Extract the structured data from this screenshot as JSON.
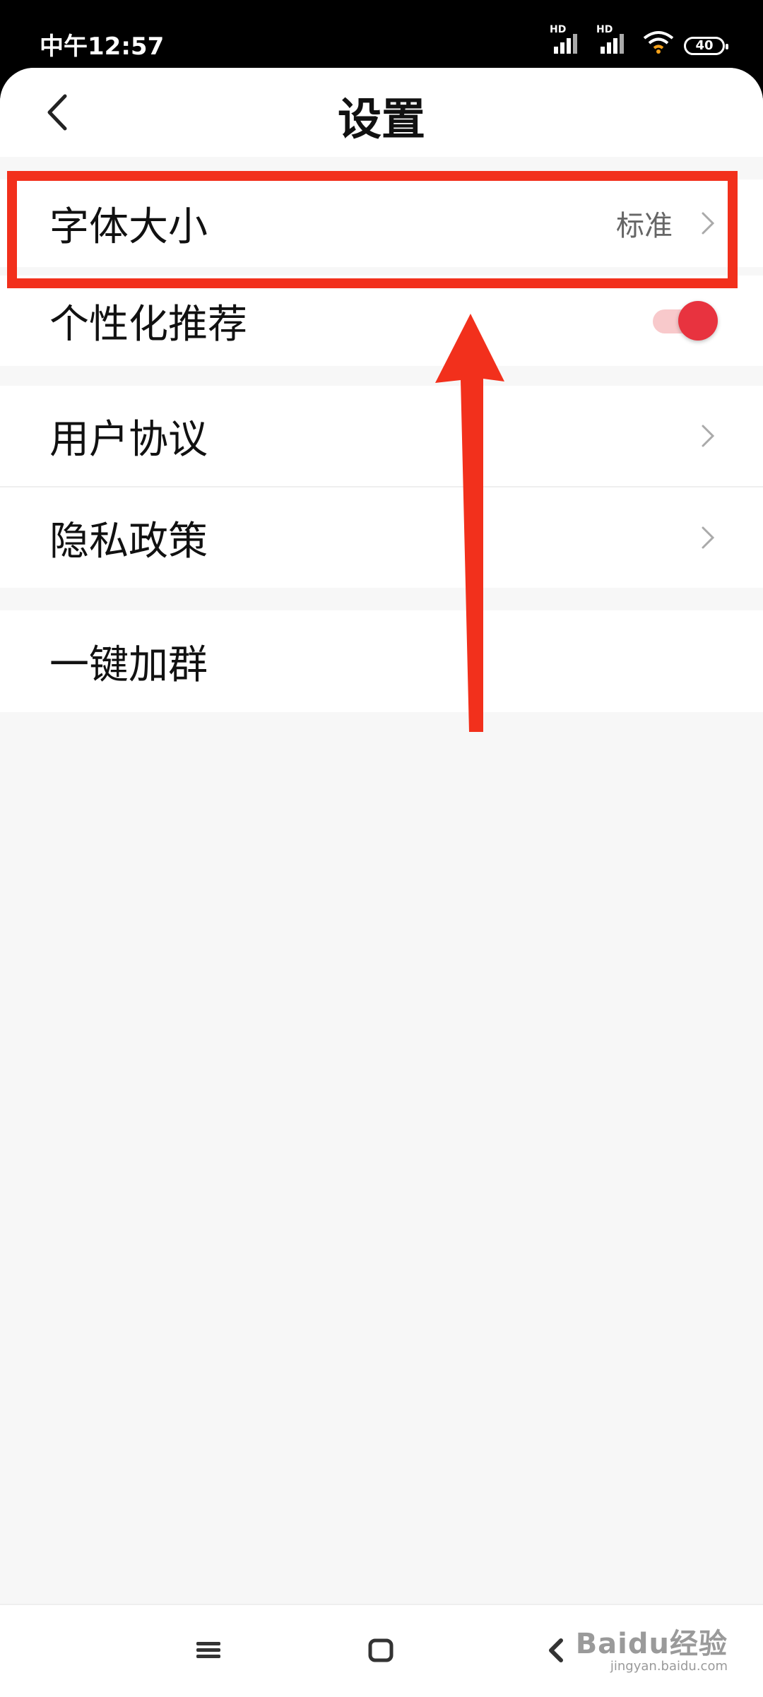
{
  "status_bar": {
    "time": "中午12:57",
    "signal1_label": "HD",
    "signal2_label": "HD",
    "battery": "40",
    "icons": [
      "signal-icon",
      "signal-icon",
      "wifi-icon",
      "battery-icon"
    ]
  },
  "header": {
    "title": "设置",
    "back_icon": "chevron-left-icon"
  },
  "settings": {
    "font_size": {
      "label": "字体大小",
      "value": "标准",
      "icon": "chevron-right-icon"
    },
    "personalized_recommend": {
      "label": "个性化推荐",
      "toggle_on": true
    },
    "user_agreement": {
      "label": "用户协议",
      "icon": "chevron-right-icon"
    },
    "privacy_policy": {
      "label": "隐私政策",
      "icon": "chevron-right-icon"
    },
    "join_group": {
      "label": "一键加群"
    }
  },
  "annotation": {
    "color": "#f2301c"
  },
  "nav_bar": {
    "icons": [
      "menu-icon",
      "home-icon",
      "back-icon"
    ]
  },
  "watermark": {
    "brand": "Baidu经验",
    "url": "jingyan.baidu.com"
  },
  "colors": {
    "accent": "#e8333f",
    "toggle_track": "#f8c9cb",
    "background": "#f7f7f7"
  }
}
